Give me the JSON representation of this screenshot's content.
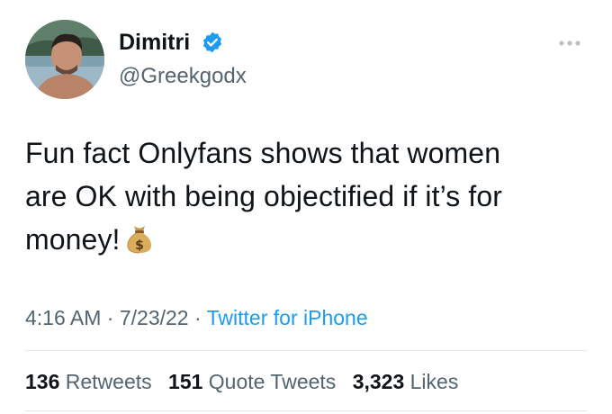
{
  "user": {
    "display_name": "Dimitri",
    "handle": "@Greekgodx",
    "verified": true,
    "avatar_icon": "profile-photo"
  },
  "tweet": {
    "text_lines": [
      "Fun fact Onlyfans shows that women",
      "are OK with being objectified if it’s for",
      "money!"
    ],
    "emoji": "money-bag-emoji"
  },
  "meta": {
    "time": "4:16 AM",
    "separator": "·",
    "date": "7/23/22",
    "source": "Twitter for iPhone"
  },
  "stats": {
    "retweets_count": "136",
    "retweets_label": "Retweets",
    "quotes_count": "151",
    "quotes_label": "Quote Tweets",
    "likes_count": "3,323",
    "likes_label": "Likes"
  },
  "colors": {
    "accent": "#1d9bf0",
    "secondary_text": "#536471",
    "primary_text": "#0f1419",
    "divider": "#e6e9eb"
  }
}
